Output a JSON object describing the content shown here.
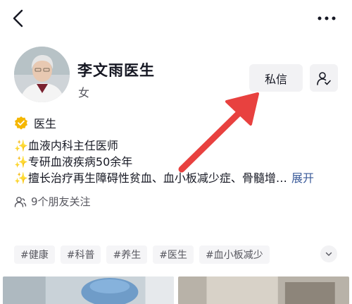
{
  "header": {
    "back_icon": "chevron-left-icon",
    "more_icon": "more-horizontal-icon"
  },
  "profile": {
    "name": "李文雨医生",
    "gender": "女",
    "message_button": "私信",
    "follow_icon": "user-check-icon"
  },
  "verification": {
    "icon": "verified-badge-icon",
    "label": "医生",
    "badge_color": "#f5b700"
  },
  "bio": {
    "lines": [
      "✨血液内科主任医师",
      "✨专研血液疾病50余年",
      "✨擅长治疗再生障碍性贫血、血小板减少症、骨髓增…"
    ],
    "expand_label": "展开"
  },
  "friends": {
    "label": "9个朋友关注"
  },
  "tags": [
    "#健康",
    "#科普",
    "#养生",
    "#医生",
    "#血小板减少"
  ],
  "annotation": {
    "arrow_color": "#e8413f"
  }
}
